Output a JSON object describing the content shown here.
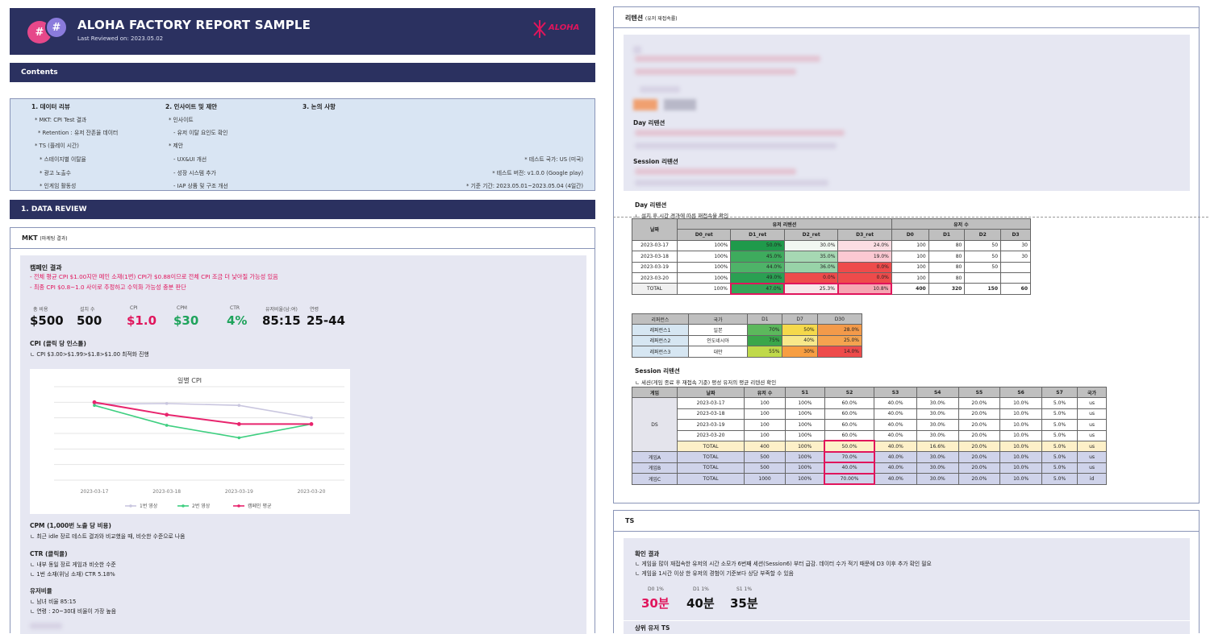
{
  "header": {
    "title": "ALOHA FACTORY REPORT SAMPLE",
    "subtitle": "Last Reviewed on: 2023.05.02",
    "brand": "ALOHA"
  },
  "contents_bar": "Contents",
  "toc": {
    "col1": {
      "title": "1. 데이터 리뷰",
      "items": [
        "* MKT: CPI Test 결과",
        "* Retention : 유저 잔존율 데이터",
        "* TS (플레이 시간)",
        "* 스테이지별 이탈율",
        "* 광고 노출수",
        "* 인게임 활동성"
      ]
    },
    "col2": {
      "title": "2. 인사이트 및 제안",
      "items": [
        "* 인사이트",
        "- 유저 이탈 요인도 확인",
        "* 제안",
        "- UX&UI 개선",
        "- 성장 시스템 추가",
        "- IAP 상품 및 구조 개선"
      ]
    },
    "col3": {
      "title": "3. 논의 사항"
    },
    "notes": [
      "* 테스트 국가: US (미국)",
      "* 테스트 버전: v1.0.0 (Google play)",
      "* 기준 기간: 2023.05.01~2023.05.04 (4일간)"
    ]
  },
  "data_review_bar": "1. DATA REVIEW",
  "mkt": {
    "header": "MKT",
    "header_sub": "(마케팅 결과)",
    "campaign_title": "캠페인 결과",
    "campaign_lines": [
      "- 전체 평균 CPI $1.00지만 메인 소재(1번) CPI가 $0.88이므로 전체 CPI 조금 더 낮아질 가능성 있음",
      "- 최종 CPI $0.8~1.0 사이로 추정하고 수익화 가능성 충분 판단"
    ],
    "metrics": [
      {
        "label": "총 비용",
        "value": "$500",
        "color": "#111111"
      },
      {
        "label": "설치 수",
        "value": "500",
        "color": "#111111"
      },
      {
        "label": "CPI",
        "value": "$1.0",
        "color": "#e0155c"
      },
      {
        "label": "CPM",
        "value": "$30",
        "color": "#1fa35c"
      },
      {
        "label": "CTR",
        "value": "4%",
        "color": "#1fa35c"
      },
      {
        "label": "유저비율(남:여)",
        "value": "85:15",
        "color": "#111111"
      },
      {
        "label": "연령",
        "value": "25-44",
        "color": "#111111"
      }
    ],
    "cpi_title": "CPI (클릭 당 인스톨)",
    "cpi_note": "ㄴ CPI $3.00>$1.99>$1.8>$1.00 최적화 진행",
    "cpm_title": "CPM (1,000번 노출 당 비용)",
    "cpm_note": "ㄴ 최근 idle 장르 테스트 결과와 비교했을 때, 비슷한 수준으로 나옴",
    "ctr_title": "CTR (클릭율)",
    "ctr_notes": [
      "ㄴ 내부 동일 장르 게임과 비슷한 수준",
      "ㄴ 1번 소재(위닝 소재) CTR 5.18%"
    ],
    "ratio_title": "유저비율",
    "ratio_notes": [
      "ㄴ 남녀 비율 85:15",
      "ㄴ 연령 : 20~30대 비율이 가장 높음"
    ]
  },
  "chart_data": {
    "type": "line",
    "title": "일별 CPI",
    "categories": [
      "2023-03-17",
      "2023-03-18",
      "2023-03-19",
      "2023-03-20"
    ],
    "ylim": [
      0,
      1.5
    ],
    "grid": true,
    "legend": "bottom",
    "series": [
      {
        "name": "1번 영상",
        "values": [
          1.22,
          1.23,
          1.2,
          1.0
        ],
        "color": "#c9c6df"
      },
      {
        "name": "2번 영상",
        "values": [
          1.2,
          0.88,
          0.68,
          0.9
        ],
        "color": "#3ecf80"
      },
      {
        "name": "캠페인 평균",
        "values": [
          1.25,
          1.05,
          0.9,
          0.9
        ],
        "color": "#e8246d"
      }
    ]
  },
  "retention": {
    "header": "리텐션",
    "header_sub": "(유저 재접속률)",
    "day_label": "Day 리텐션",
    "session_label": "Session 리텐션",
    "day_title": "Day 리텐션",
    "day_note": "ㄴ 설치 후 시간 경과에 따른 재접속율 확인",
    "day_table": {
      "group1": "유저 리텐션",
      "group2": "유저 수",
      "date_header": "날짜",
      "columns": [
        "D0_ret",
        "D1_ret",
        "D2_ret",
        "D3_ret",
        "D0",
        "D1",
        "D2",
        "D3"
      ],
      "rows": [
        [
          "2023-03-17",
          "100%",
          "50.0%",
          "30.0%",
          "24.0%",
          "100",
          "80",
          "50",
          "30"
        ],
        [
          "2023-03-18",
          "100%",
          "45.0%",
          "35.0%",
          "19.0%",
          "100",
          "80",
          "50",
          "30"
        ],
        [
          "2023-03-19",
          "100%",
          "44.0%",
          "36.0%",
          "0.0%",
          "100",
          "80",
          "50",
          ""
        ],
        [
          "2023-03-20",
          "100%",
          "49.0%",
          "0.0%",
          "0.0%",
          "100",
          "80",
          "",
          ""
        ],
        [
          "TOTAL",
          "100%",
          "47.0%",
          "25.3%",
          "10.8%",
          "400",
          "320",
          "150",
          "60"
        ]
      ]
    },
    "ref_table": {
      "columns": [
        "리퍼런스",
        "국가",
        "D1",
        "D7",
        "D30"
      ],
      "rows": [
        [
          "레퍼런스1",
          "일본",
          "70%",
          "50%",
          "28.0%"
        ],
        [
          "레퍼런스2",
          "인도네시아",
          "75%",
          "40%",
          "25.0%"
        ],
        [
          "레퍼런스3",
          "대만",
          "55%",
          "30%",
          "14.0%"
        ]
      ]
    },
    "session_title": "Session 리텐션",
    "session_note": "ㄴ 세션(게임 종료 후 재접속 기준) 평성 유저의 평균 리텐션 확인",
    "session_table": {
      "columns": [
        "게임",
        "날짜",
        "유저 수",
        "S1",
        "S2",
        "S3",
        "S4",
        "S5",
        "S6",
        "S7",
        "국가"
      ],
      "ds_label": "DS",
      "ds_rows": [
        [
          "2023-03-17",
          "100",
          "100%",
          "60.0%",
          "40.0%",
          "30.0%",
          "20.0%",
          "10.0%",
          "5.0%",
          "us"
        ],
        [
          "2023-03-18",
          "100",
          "100%",
          "60.0%",
          "40.0%",
          "30.0%",
          "20.0%",
          "10.0%",
          "5.0%",
          "us"
        ],
        [
          "2023-03-19",
          "100",
          "100%",
          "60.0%",
          "40.0%",
          "30.0%",
          "20.0%",
          "10.0%",
          "5.0%",
          "us"
        ],
        [
          "2023-03-20",
          "100",
          "100%",
          "60.0%",
          "40.0%",
          "30.0%",
          "20.0%",
          "10.0%",
          "5.0%",
          "us"
        ],
        [
          "TOTAL",
          "400",
          "100%",
          "50.0%",
          "40.0%",
          "16.6%",
          "20.0%",
          "10.0%",
          "5.0%",
          "us"
        ]
      ],
      "game_rows": [
        [
          "게임A",
          "TOTAL",
          "500",
          "100%",
          "70.0%",
          "40.0%",
          "30.0%",
          "20.0%",
          "10.0%",
          "5.0%",
          "us"
        ],
        [
          "게임B",
          "TOTAL",
          "500",
          "100%",
          "40.0%",
          "40.0%",
          "30.0%",
          "20.0%",
          "10.0%",
          "5.0%",
          "us"
        ],
        [
          "게임C",
          "TOTAL",
          "1000",
          "100%",
          "70.00%",
          "40.0%",
          "30.0%",
          "20.0%",
          "10.0%",
          "5.0%",
          "id"
        ]
      ]
    }
  },
  "ts": {
    "header": "TS",
    "result_title": "확인 결과",
    "notes": [
      "ㄴ 게임을 많이 재접속한 유저의 시간 소모가 6번째 세션(Session6) 부터 급감. 데이터 수가 적기 때문에 D3 이후 추가 확인 필요",
      "ㄴ 게임을 1시간 이상 한 유저의 경험이 기준보다 상당 부족할 수 있음"
    ],
    "metrics": [
      {
        "label": "D0 1%",
        "value": "30분",
        "color": "#e0155c"
      },
      {
        "label": "D1 1%",
        "value": "40분",
        "color": "#111111"
      },
      {
        "label": "S1 1%",
        "value": "35분",
        "color": "#111111"
      }
    ],
    "top_title": "상위 유저 TS"
  }
}
